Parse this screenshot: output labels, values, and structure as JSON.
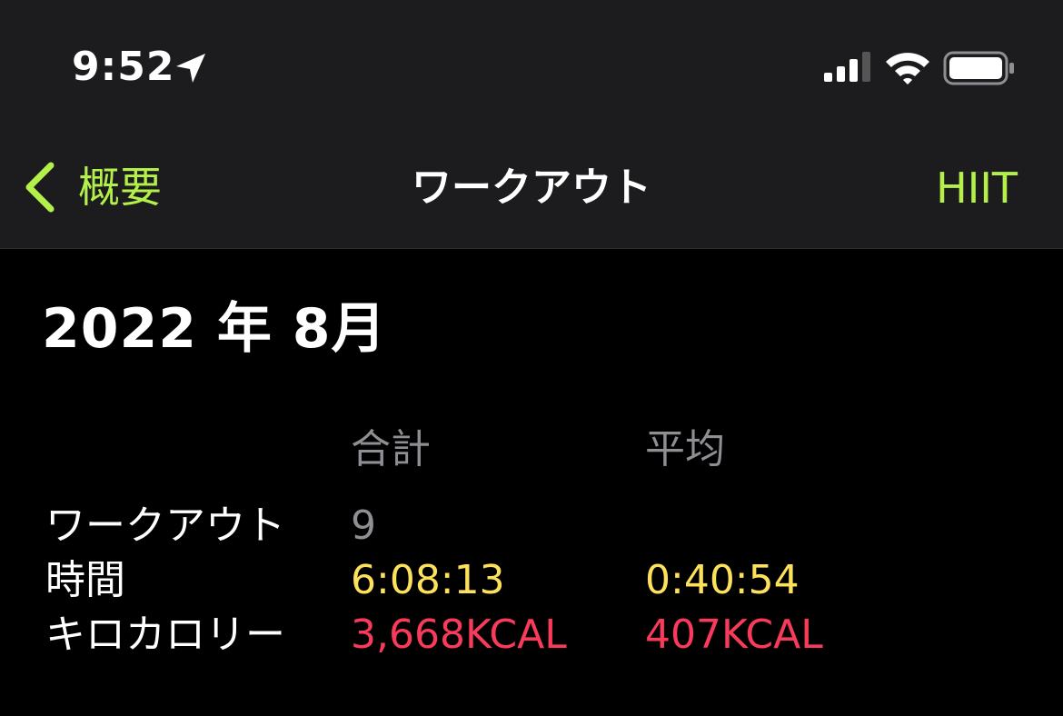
{
  "status_bar": {
    "time": "9:52",
    "icons": [
      "location-arrow-icon",
      "cellular-signal-icon",
      "wifi-icon",
      "battery-icon"
    ]
  },
  "nav": {
    "back_label": "概要",
    "title": "ワークアウト",
    "action_label": "HIIT"
  },
  "month_heading": "2022 年 8月",
  "summary": {
    "headers": {
      "total": "合計",
      "average": "平均"
    },
    "rows": [
      {
        "label": "ワークアウト",
        "total": "9",
        "average": ""
      },
      {
        "label": "時間",
        "total": "6:08:13",
        "average": "0:40:54"
      },
      {
        "label": "キロカロリー",
        "total": "3,668KCAL",
        "average": "407KCAL"
      }
    ]
  },
  "colors": {
    "accent": "#b4f04a",
    "time_value": "#fde15b",
    "calorie_value": "#fa3a5a",
    "secondary_text": "#8e8e93",
    "bar_background": "#1c1c1e",
    "page_background": "#000000"
  }
}
